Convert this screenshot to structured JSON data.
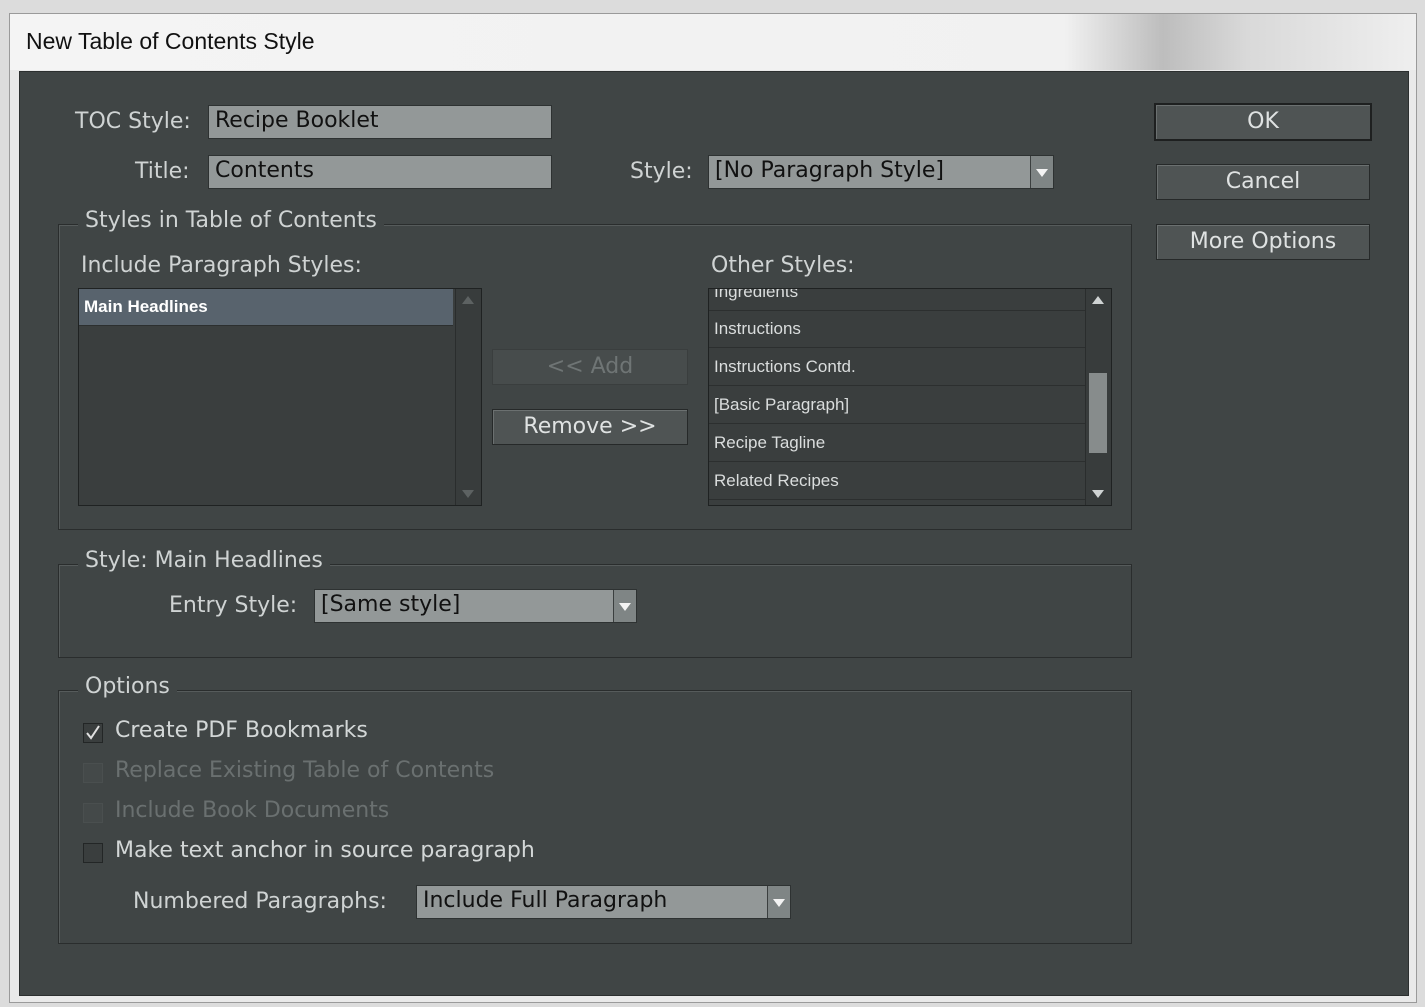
{
  "window": {
    "title": "New Table of Contents Style"
  },
  "toc_style": {
    "label": "TOC Style:",
    "value": "Recipe Booklet"
  },
  "title_field": {
    "label": "Title:",
    "value": "Contents"
  },
  "title_style": {
    "label": "Style:",
    "value": "[No Paragraph Style]"
  },
  "buttons": {
    "ok": "OK",
    "cancel": "Cancel",
    "more_options": "More Options",
    "add": "<< Add",
    "remove": "Remove >>"
  },
  "styles_group": {
    "title": "Styles in Table of Contents",
    "include_label": "Include Paragraph Styles:",
    "include_items": [
      "Main Headlines"
    ],
    "other_label": "Other Styles:",
    "other_items": [
      "Ingredients",
      "Instructions",
      "Instructions Contd.",
      "[Basic Paragraph]",
      "Recipe Tagline",
      "Related Recipes"
    ]
  },
  "style_group": {
    "title": "Style: Main Headlines",
    "entry_label": "Entry Style:",
    "entry_value": "[Same style]"
  },
  "options": {
    "title": "Options",
    "create_pdf": {
      "label": "Create PDF Bookmarks",
      "checked": true
    },
    "replace_toc": {
      "label": "Replace Existing Table of Contents",
      "checked": false,
      "disabled": true
    },
    "include_book": {
      "label": "Include Book Documents",
      "checked": false,
      "disabled": true
    },
    "text_anchor": {
      "label": "Make text anchor in source paragraph",
      "checked": false
    },
    "numbered_label": "Numbered Paragraphs:",
    "numbered_value": "Include Full Paragraph"
  }
}
